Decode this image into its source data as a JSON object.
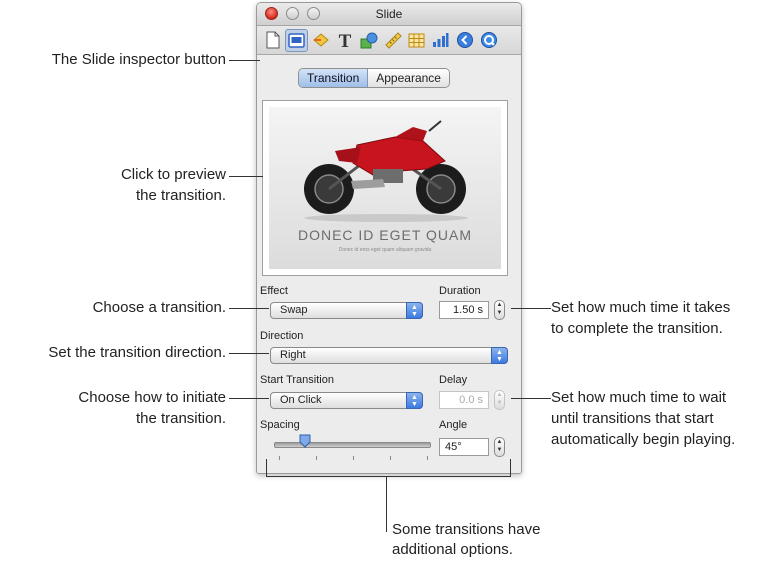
{
  "window": {
    "title": "Slide"
  },
  "toolbar": {
    "buttons": [
      {
        "icon": "document-icon",
        "active": false
      },
      {
        "icon": "slide-icon",
        "active": true
      },
      {
        "icon": "build-icon",
        "active": false
      },
      {
        "icon": "text-icon",
        "active": false
      },
      {
        "icon": "graphic-icon",
        "active": false
      },
      {
        "icon": "metrics-icon",
        "active": false
      },
      {
        "icon": "table-icon",
        "active": false
      },
      {
        "icon": "chart-icon",
        "active": false
      },
      {
        "icon": "hyperlink-icon",
        "active": false
      },
      {
        "icon": "quicktime-icon",
        "active": false
      }
    ]
  },
  "tabs": {
    "transition": "Transition",
    "appearance": "Appearance",
    "selected": "Transition"
  },
  "preview": {
    "slide_title": "DONEC ID EGET QUAM",
    "slide_subtitle": "Donec id eros eget quam aliquam gravida"
  },
  "effect": {
    "label": "Effect",
    "value": "Swap"
  },
  "duration": {
    "label": "Duration",
    "value": "1.50 s"
  },
  "direction": {
    "label": "Direction",
    "value": "Right"
  },
  "start_transition": {
    "label": "Start Transition",
    "value": "On Click"
  },
  "delay": {
    "label": "Delay",
    "value": "0.0 s"
  },
  "spacing": {
    "label": "Spacing",
    "level": 0.2
  },
  "angle": {
    "label": "Angle",
    "value": "45°"
  },
  "callouts": {
    "inspector_button": "The Slide inspector button",
    "preview_line1": "Click to preview",
    "preview_line2": "the transition.",
    "choose_transition": "Choose a transition.",
    "direction": "Set the transition direction.",
    "initiate_line1": "Choose how to initiate",
    "initiate_line2": "the transition.",
    "duration_line1": "Set how much time it takes",
    "duration_line2": "to complete the transition.",
    "delay_line1": "Set how much time to wait",
    "delay_line2": "until transitions that start",
    "delay_line3": "automatically begin playing.",
    "options_line1": "Some transitions have",
    "options_line2": "additional options."
  },
  "colors": {
    "accent_blue": "#3c7ae0",
    "close_red": "#d2281b",
    "bike_red": "#c8141e"
  }
}
